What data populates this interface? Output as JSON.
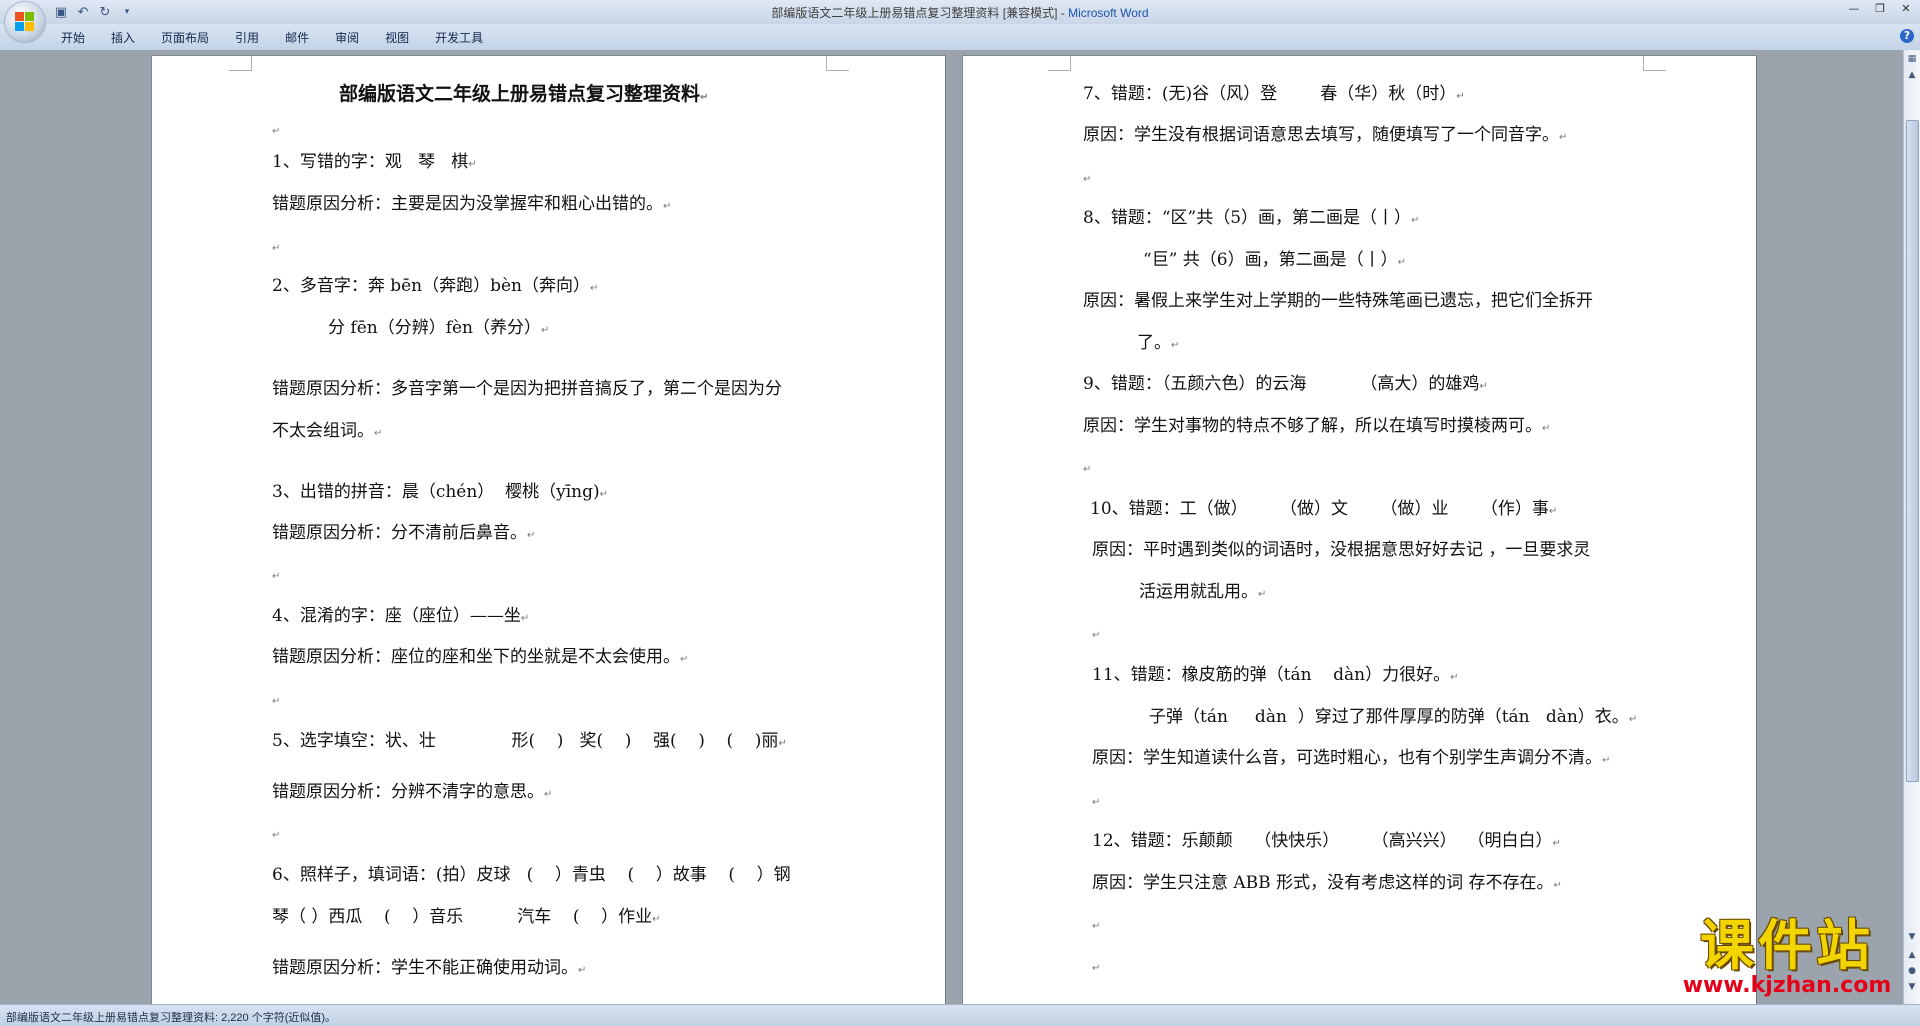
{
  "window": {
    "title": "部编版语文二年级上册易错点复习整理资料 [兼容模式] - ",
    "app_name": "Microsoft Word"
  },
  "quick_access": [
    "save-icon",
    "undo-icon",
    "redo-icon",
    "customize-icon"
  ],
  "ribbon_tabs": [
    "开始",
    "插入",
    "页面布局",
    "引用",
    "邮件",
    "审阅",
    "视图",
    "开发工具"
  ],
  "document": {
    "left_page": {
      "title": "部编版语文二年级上册易错点复习整理资料",
      "lines": [
        "1、写错的字：观   琴   棋",
        "错题原因分析：主要是因为没掌握牢和粗心出错的。",
        "2、多音字：奔 bēn（奔跑）bèn（奔向）",
        "分 fēn（分辨）fèn（养分）",
        "错题原因分析：多音字第一个是因为把拼音搞反了，第二个是因为分",
        "不太会组词。",
        "3、出错的拼音：晨（chén）  樱桃（yīng)",
        "错题原因分析：分不清前后鼻音。",
        "4、混淆的字：座（座位）——坐",
        "错题原因分析：座位的座和坐下的坐就是不太会使用。",
        "5、选字填空：状、壮              形(    )   奖(    )    强(    )    (    )丽",
        "错题原因分析：分辨不清字的意思。",
        "6、照样子，填词语：(拍）皮球   (    ）青虫    (    ）故事    (    ）钢",
        "琴（ ）西瓜    (    ）音乐          汽车    (    ）作业",
        "错题原因分析：学生不能正确使用动词。"
      ]
    },
    "right_page": {
      "lines": [
        "7、错题：(无)谷（风）登        春（华）秋（时）",
        "原因：学生没有根据词语意思去填写，随便填写了一个同音字。",
        "8、错题：“区”共（5）画，第二画是（丨）",
        "“巨” 共（6）画，第二画是（丨）",
        "原因：暑假上来学生对上学期的一些特殊笔画已遗忘，把它们全拆开",
        "了。",
        "9、错题：（五颜六色）的云海          （高大）的雄鸡",
        "原因：学生对事物的特点不够了解，所以在填写时摸棱两可。",
        "10、错题：工（做）      （做）文      （做）业      （作）事",
        "原因：平时遇到类似的词语时，没根据意思好好去记 ，一旦要求灵",
        "活运用就乱用。",
        "11、错题：橡皮筋的弹（tán    dàn）力很好。",
        "子弹（tán     dàn  ）穿过了那件厚厚的防弹（tán   dàn）衣。",
        "原因：学生知道读什么音，可选时粗心，也有个别学生声调分不清。",
        "12、错题：乐颠颠    （快快乐）      （高兴兴）  （明白白）",
        "原因：学生只注意 ABB 形式，没有考虑这样的词 存不存在。"
      ]
    },
    "paragraph_mark": "↵"
  },
  "status_bar": {
    "text": "部编版语文二年级上册易错点复习整理资料: 2,220 个字符(近似值)。"
  },
  "watermark": {
    "main": "课件站",
    "url": "www.kjzhan.com"
  },
  "colors": {
    "title_bar": "#dfe8f4",
    "workspace": "#9ba4ad",
    "app_name_accent": "#1e55b0",
    "watermark_yellow": "#f2d400",
    "watermark_red": "#e5001a"
  }
}
